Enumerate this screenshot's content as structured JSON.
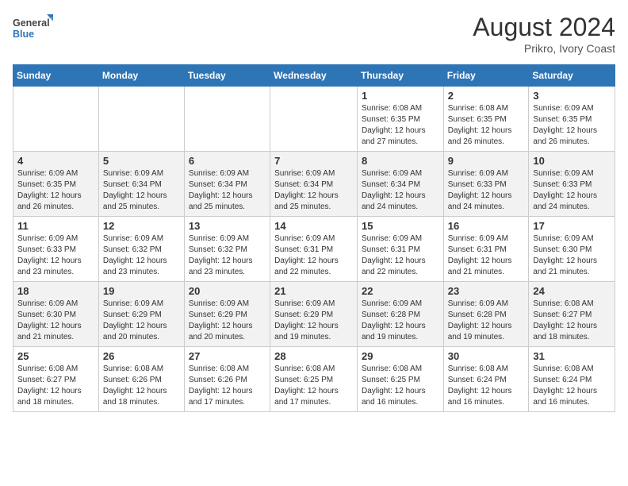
{
  "header": {
    "logo_line1": "General",
    "logo_line2": "Blue",
    "month_year": "August 2024",
    "location": "Prikro, Ivory Coast"
  },
  "weekdays": [
    "Sunday",
    "Monday",
    "Tuesday",
    "Wednesday",
    "Thursday",
    "Friday",
    "Saturday"
  ],
  "weeks": [
    [
      {
        "day": "",
        "info": ""
      },
      {
        "day": "",
        "info": ""
      },
      {
        "day": "",
        "info": ""
      },
      {
        "day": "",
        "info": ""
      },
      {
        "day": "1",
        "info": "Sunrise: 6:08 AM\nSunset: 6:35 PM\nDaylight: 12 hours\nand 27 minutes."
      },
      {
        "day": "2",
        "info": "Sunrise: 6:08 AM\nSunset: 6:35 PM\nDaylight: 12 hours\nand 26 minutes."
      },
      {
        "day": "3",
        "info": "Sunrise: 6:09 AM\nSunset: 6:35 PM\nDaylight: 12 hours\nand 26 minutes."
      }
    ],
    [
      {
        "day": "4",
        "info": "Sunrise: 6:09 AM\nSunset: 6:35 PM\nDaylight: 12 hours\nand 26 minutes."
      },
      {
        "day": "5",
        "info": "Sunrise: 6:09 AM\nSunset: 6:34 PM\nDaylight: 12 hours\nand 25 minutes."
      },
      {
        "day": "6",
        "info": "Sunrise: 6:09 AM\nSunset: 6:34 PM\nDaylight: 12 hours\nand 25 minutes."
      },
      {
        "day": "7",
        "info": "Sunrise: 6:09 AM\nSunset: 6:34 PM\nDaylight: 12 hours\nand 25 minutes."
      },
      {
        "day": "8",
        "info": "Sunrise: 6:09 AM\nSunset: 6:34 PM\nDaylight: 12 hours\nand 24 minutes."
      },
      {
        "day": "9",
        "info": "Sunrise: 6:09 AM\nSunset: 6:33 PM\nDaylight: 12 hours\nand 24 minutes."
      },
      {
        "day": "10",
        "info": "Sunrise: 6:09 AM\nSunset: 6:33 PM\nDaylight: 12 hours\nand 24 minutes."
      }
    ],
    [
      {
        "day": "11",
        "info": "Sunrise: 6:09 AM\nSunset: 6:33 PM\nDaylight: 12 hours\nand 23 minutes."
      },
      {
        "day": "12",
        "info": "Sunrise: 6:09 AM\nSunset: 6:32 PM\nDaylight: 12 hours\nand 23 minutes."
      },
      {
        "day": "13",
        "info": "Sunrise: 6:09 AM\nSunset: 6:32 PM\nDaylight: 12 hours\nand 23 minutes."
      },
      {
        "day": "14",
        "info": "Sunrise: 6:09 AM\nSunset: 6:31 PM\nDaylight: 12 hours\nand 22 minutes."
      },
      {
        "day": "15",
        "info": "Sunrise: 6:09 AM\nSunset: 6:31 PM\nDaylight: 12 hours\nand 22 minutes."
      },
      {
        "day": "16",
        "info": "Sunrise: 6:09 AM\nSunset: 6:31 PM\nDaylight: 12 hours\nand 21 minutes."
      },
      {
        "day": "17",
        "info": "Sunrise: 6:09 AM\nSunset: 6:30 PM\nDaylight: 12 hours\nand 21 minutes."
      }
    ],
    [
      {
        "day": "18",
        "info": "Sunrise: 6:09 AM\nSunset: 6:30 PM\nDaylight: 12 hours\nand 21 minutes."
      },
      {
        "day": "19",
        "info": "Sunrise: 6:09 AM\nSunset: 6:29 PM\nDaylight: 12 hours\nand 20 minutes."
      },
      {
        "day": "20",
        "info": "Sunrise: 6:09 AM\nSunset: 6:29 PM\nDaylight: 12 hours\nand 20 minutes."
      },
      {
        "day": "21",
        "info": "Sunrise: 6:09 AM\nSunset: 6:29 PM\nDaylight: 12 hours\nand 19 minutes."
      },
      {
        "day": "22",
        "info": "Sunrise: 6:09 AM\nSunset: 6:28 PM\nDaylight: 12 hours\nand 19 minutes."
      },
      {
        "day": "23",
        "info": "Sunrise: 6:09 AM\nSunset: 6:28 PM\nDaylight: 12 hours\nand 19 minutes."
      },
      {
        "day": "24",
        "info": "Sunrise: 6:08 AM\nSunset: 6:27 PM\nDaylight: 12 hours\nand 18 minutes."
      }
    ],
    [
      {
        "day": "25",
        "info": "Sunrise: 6:08 AM\nSunset: 6:27 PM\nDaylight: 12 hours\nand 18 minutes."
      },
      {
        "day": "26",
        "info": "Sunrise: 6:08 AM\nSunset: 6:26 PM\nDaylight: 12 hours\nand 18 minutes."
      },
      {
        "day": "27",
        "info": "Sunrise: 6:08 AM\nSunset: 6:26 PM\nDaylight: 12 hours\nand 17 minutes."
      },
      {
        "day": "28",
        "info": "Sunrise: 6:08 AM\nSunset: 6:25 PM\nDaylight: 12 hours\nand 17 minutes."
      },
      {
        "day": "29",
        "info": "Sunrise: 6:08 AM\nSunset: 6:25 PM\nDaylight: 12 hours\nand 16 minutes."
      },
      {
        "day": "30",
        "info": "Sunrise: 6:08 AM\nSunset: 6:24 PM\nDaylight: 12 hours\nand 16 minutes."
      },
      {
        "day": "31",
        "info": "Sunrise: 6:08 AM\nSunset: 6:24 PM\nDaylight: 12 hours\nand 16 minutes."
      }
    ]
  ]
}
